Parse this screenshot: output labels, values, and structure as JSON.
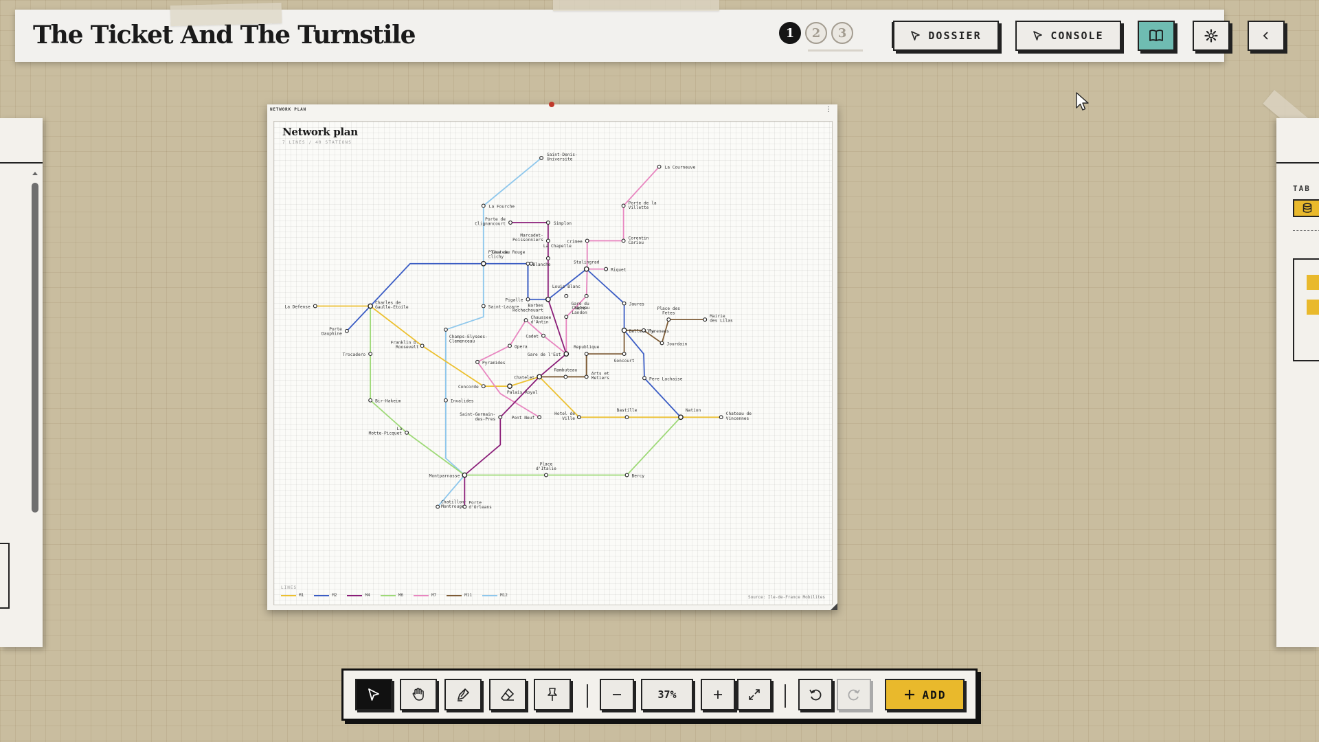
{
  "app": {
    "title": "The Ticket And The Turnstile"
  },
  "header": {
    "steps": [
      "1",
      "2",
      "3"
    ],
    "active_step": "1",
    "dossier_label": "DOSSIER",
    "console_label": "CONSOLE",
    "icons": [
      "cursor-icon",
      "book-icon",
      "gear-icon",
      "chevron-left-icon"
    ]
  },
  "right_panel": {
    "label": "TAB"
  },
  "card": {
    "tab_label": "NETWORK PLAN",
    "title": "Network plan",
    "subtitle": "7 LINES / 40 STATIONS",
    "legend_title": "LINES",
    "source": "Source: Ile-de-France Mobilites"
  },
  "lines": [
    {
      "id": "M1",
      "name": "M1",
      "color": "#ecc02f"
    },
    {
      "id": "M2",
      "name": "M2",
      "color": "#3a5cc4"
    },
    {
      "id": "M4",
      "name": "M4",
      "color": "#8a1d78"
    },
    {
      "id": "M6",
      "name": "M6",
      "color": "#9ed977"
    },
    {
      "id": "M7",
      "name": "M7",
      "color": "#e886c0"
    },
    {
      "id": "M11",
      "name": "M11",
      "color": "#7d5b35"
    },
    {
      "id": "M12",
      "name": "M12",
      "color": "#8ec7ec"
    }
  ],
  "stations": [
    {
      "id": "sdu",
      "label": "Saint-Denis-\nUniversite"
    },
    {
      "id": "laf",
      "label": "La Fourche"
    },
    {
      "id": "pdc",
      "label": "Porte de\nClignancourt"
    },
    {
      "id": "sim",
      "label": "Simplon"
    },
    {
      "id": "mpo",
      "label": "Marcadet-\nPoissonniers"
    },
    {
      "id": "cha",
      "label": "Chateau Rouge"
    },
    {
      "id": "lch",
      "label": "La Chapelle"
    },
    {
      "id": "pcl",
      "label": "Place de\nClichy"
    },
    {
      "id": "bla",
      "label": "Blanche"
    },
    {
      "id": "pig",
      "label": "Pigalle"
    },
    {
      "id": "bar",
      "label": "Barbes\nRochechouart"
    },
    {
      "id": "lbl",
      "label": "Louis Blanc"
    },
    {
      "id": "sta",
      "label": "Stalingrad"
    },
    {
      "id": "gdn",
      "label": "Gare du\nNord"
    },
    {
      "id": "cla",
      "label": "Chateau\nLandon"
    },
    {
      "id": "lco",
      "label": "La Courneuve"
    },
    {
      "id": "pvi",
      "label": "Porte de la\nVillette"
    },
    {
      "id": "cri",
      "label": "Crimee"
    },
    {
      "id": "cca",
      "label": "Corentin\nCariou"
    },
    {
      "id": "riq",
      "label": "Riquet"
    },
    {
      "id": "jau",
      "label": "Jaures"
    },
    {
      "id": "bel",
      "label": "Belleville"
    },
    {
      "id": "pyr",
      "label": "Pyrenees"
    },
    {
      "id": "pfe",
      "label": "Place des\nFetes"
    },
    {
      "id": "mli",
      "label": "Mairie\ndes Lilas"
    },
    {
      "id": "jou",
      "label": "Jourdain"
    },
    {
      "id": "gon",
      "label": "Goncourt"
    },
    {
      "id": "rep",
      "label": "Republique"
    },
    {
      "id": "gde",
      "label": "Gare de l'Est"
    },
    {
      "id": "cad",
      "label": "Cadet"
    },
    {
      "id": "cda",
      "label": "Chaussee\nd'Antin"
    },
    {
      "id": "ope",
      "label": "Opera"
    },
    {
      "id": "pyd",
      "label": "Pyramides"
    },
    {
      "id": "ldf",
      "label": "La Defense"
    },
    {
      "id": "cdg",
      "label": "Charles de\nGaulle-Etoile"
    },
    {
      "id": "pda",
      "label": "Porte\nDauphine"
    },
    {
      "id": "slz",
      "label": "Saint-Lazare"
    },
    {
      "id": "tro",
      "label": "Trocadero"
    },
    {
      "id": "fdr",
      "label": "Franklin D.\nRoosevelt"
    },
    {
      "id": "cec",
      "label": "Champs-Elysees-\nClemenceau"
    },
    {
      "id": "con",
      "label": "Concorde"
    },
    {
      "id": "pro",
      "label": "Palais Royal"
    },
    {
      "id": "chl",
      "label": "Chatelet"
    },
    {
      "id": "ram",
      "label": "Rambuteau"
    },
    {
      "id": "aem",
      "label": "Arts et\nMetiers"
    },
    {
      "id": "inv",
      "label": "Invalides"
    },
    {
      "id": "bih",
      "label": "Bir-Hakeim"
    },
    {
      "id": "lmp",
      "label": "La\nMotte-Picquet"
    },
    {
      "id": "sgp",
      "label": "Saint-Germain-\ndes-Pres"
    },
    {
      "id": "pne",
      "label": "Pont Neuf"
    },
    {
      "id": "hdv",
      "label": "Hotel de\nVille"
    },
    {
      "id": "bas",
      "label": "Bastille"
    },
    {
      "id": "nat",
      "label": "Nation"
    },
    {
      "id": "cdv",
      "label": "Chateau de\nVincennes"
    },
    {
      "id": "ple",
      "label": "Pere Lachaise"
    },
    {
      "id": "mon",
      "label": "Montparnasse"
    },
    {
      "id": "pit",
      "label": "Place\nd'Italie"
    },
    {
      "id": "ber",
      "label": "Bercy"
    },
    {
      "id": "cmo",
      "label": "Chatillon-\nMontrouge"
    },
    {
      "id": "por",
      "label": "Porte\nd'Orleans"
    }
  ],
  "toolbar": {
    "tools": [
      "select-tool",
      "pan-tool",
      "draw-tool",
      "erase-tool",
      "pin-tool"
    ],
    "active_tool": "select-tool",
    "zoom_label": "37%",
    "add_label": "ADD"
  }
}
